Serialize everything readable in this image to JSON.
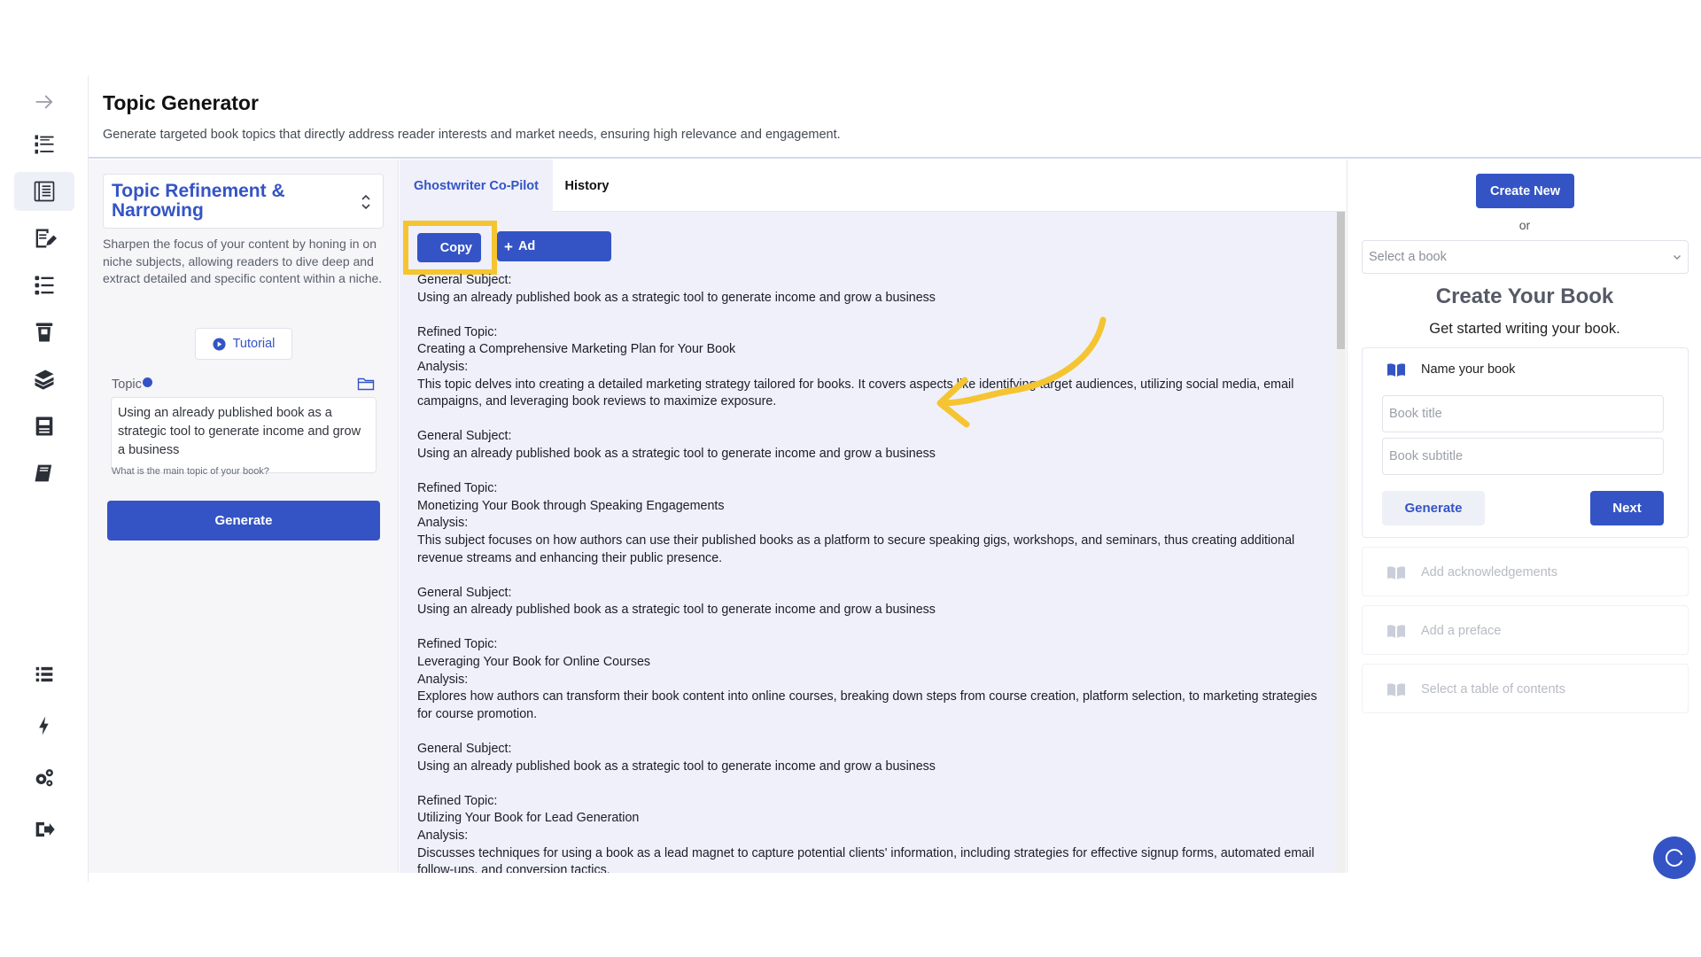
{
  "header": {
    "title": "Topic Generator",
    "description": "Generate targeted book topics that directly address reader interests and market needs, ensuring high relevance and engagement."
  },
  "rail": {
    "icons": [
      "arrow-right-icon",
      "numbered-list-icon",
      "outline-book-icon",
      "edit-page-icon",
      "checklist-icon",
      "trash-page-icon",
      "stacked-books-icon",
      "printer-icon",
      "book-icon",
      "list-icon",
      "lightning-icon",
      "gears-icon",
      "logout-icon"
    ],
    "active_index": 2
  },
  "left_panel": {
    "mode_title": "Topic Refinement & Narrowing",
    "mode_description": "Sharpen the focus of your content by honing in on niche subjects, allowing readers to dive deep and extract detailed and specific content within a niche.",
    "tutorial_label": "Tutorial",
    "topic_label": "Topic",
    "topic_value": "Using an already published book as a strategic tool to generate income and grow a business",
    "topic_help": "What is the main topic of your book?",
    "generate_label": "Generate"
  },
  "center_panel": {
    "tabs": [
      {
        "label": "Ghostwriter Co-Pilot",
        "active": true
      },
      {
        "label": "History",
        "active": false
      }
    ],
    "copy_label": "Copy",
    "add_label": "Ad",
    "results": [
      {
        "lines": [
          "General Subject:",
          "Using an already published book as a strategic tool to generate income and grow a business"
        ]
      },
      {
        "lines": [
          "Refined Topic:",
          "Creating a Comprehensive Marketing Plan for Your Book",
          "Analysis:",
          "This topic delves into creating a detailed marketing strategy tailored for books. It covers aspects like identifying target audiences, utilizing social media, email campaigns, and leveraging book reviews to maximize exposure."
        ]
      },
      {
        "lines": [
          "General Subject:",
          "Using an already published book as a strategic tool to generate income and grow a business"
        ]
      },
      {
        "lines": [
          "Refined Topic:",
          "Monetizing Your Book through Speaking Engagements",
          "Analysis:",
          "This subject focuses on how authors can use their published books as a platform to secure speaking gigs, workshops, and seminars, thus creating additional revenue streams and enhancing their public presence."
        ]
      },
      {
        "lines": [
          "General Subject:",
          "Using an already published book as a strategic tool to generate income and grow a business"
        ]
      },
      {
        "lines": [
          "Refined Topic:",
          "Leveraging Your Book for Online Courses",
          "Analysis:",
          "Explores how authors can transform their book content into online courses, breaking down steps from course creation, platform selection, to marketing strategies for course promotion."
        ]
      },
      {
        "lines": [
          "General Subject:",
          "Using an already published book as a strategic tool to generate income and grow a business"
        ]
      },
      {
        "lines": [
          "Refined Topic:",
          "Utilizing Your Book for Lead Generation",
          "Analysis:",
          "Discusses techniques for using a book as a lead magnet to capture potential clients' information, including strategies for effective signup forms, automated email follow-ups, and conversion tactics."
        ]
      }
    ]
  },
  "right_panel": {
    "create_new_label": "Create New",
    "or_label": "or",
    "select_book_placeholder": "Select a book",
    "title": "Create Your Book",
    "subtitle": "Get started writing your book.",
    "steps": {
      "name_label": "Name your book",
      "title_placeholder": "Book title",
      "subtitle_placeholder": "Book subtitle",
      "generate_label": "Generate",
      "next_label": "Next"
    },
    "disabled_steps": [
      "Add acknowledgements",
      "Add a preface",
      "Select a table of contents"
    ]
  },
  "colors": {
    "accent": "#3454c5",
    "highlight": "#f5c431",
    "center_bg": "#eff0fa"
  }
}
